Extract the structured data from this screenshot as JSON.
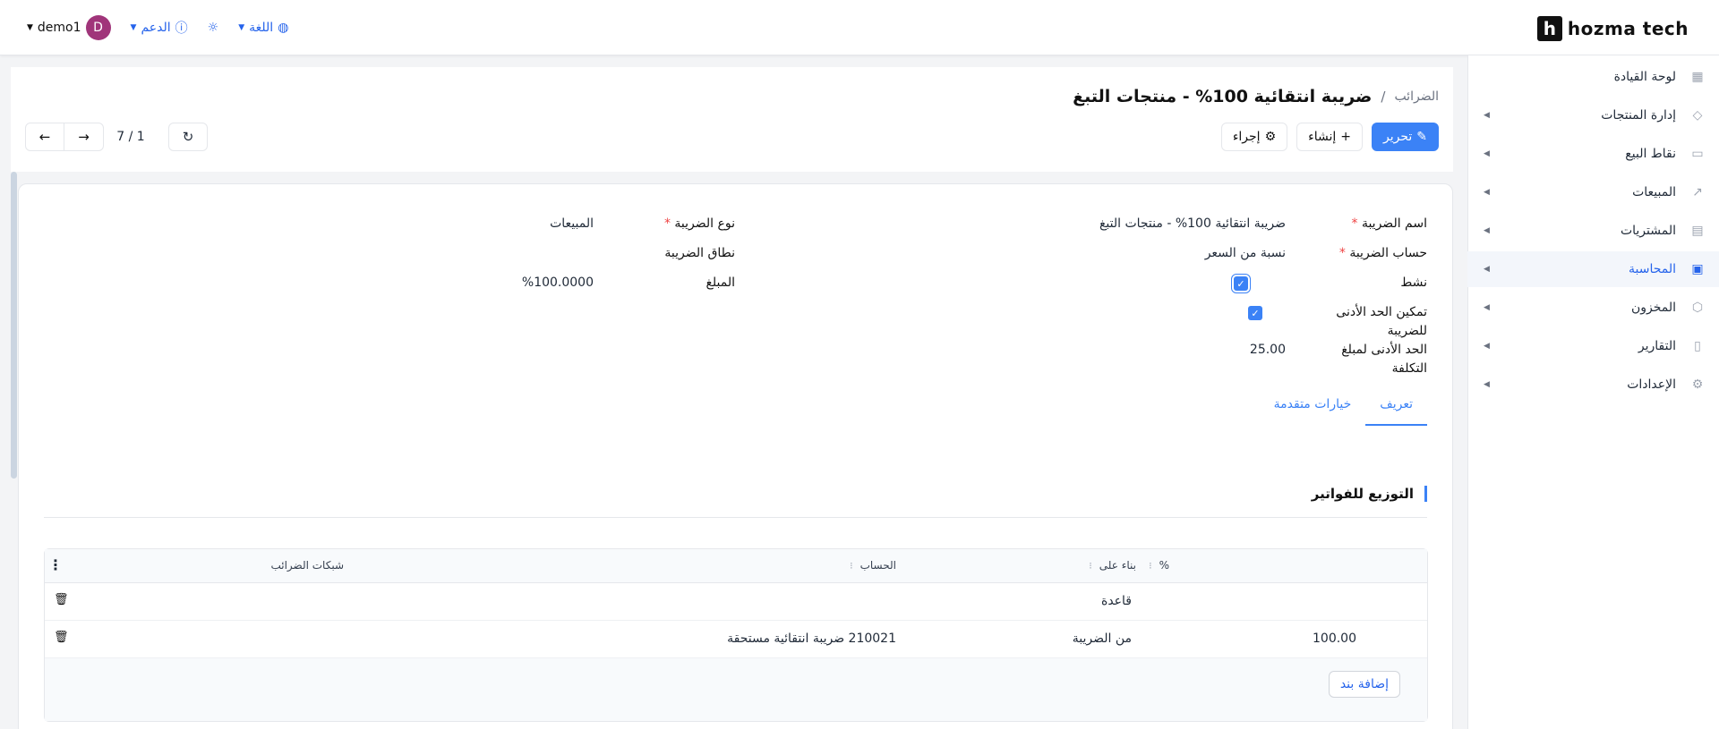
{
  "brand": {
    "logo_letter": "h",
    "name": "hozma tech"
  },
  "topbar": {
    "user": "demo1",
    "avatar_letter": "D",
    "support": "الدعم",
    "language": "اللغة"
  },
  "sidebar": {
    "items": [
      {
        "label": "لوحة القيادة",
        "icon": "dashboard-icon"
      },
      {
        "label": "إدارة المنتجات",
        "icon": "tag-icon"
      },
      {
        "label": "نقاط البيع",
        "icon": "store-icon"
      },
      {
        "label": "المبيعات",
        "icon": "chart-line-icon"
      },
      {
        "label": "المشتريات",
        "icon": "wallet-icon"
      },
      {
        "label": "المحاسبة",
        "icon": "calculator-icon"
      },
      {
        "label": "المخزون",
        "icon": "box-icon"
      },
      {
        "label": "التقارير",
        "icon": "report-icon"
      },
      {
        "label": "الإعدادات",
        "icon": "gear-icon"
      }
    ]
  },
  "header": {
    "breadcrumb_parent": "الضرائب",
    "breadcrumb_sep": "/",
    "title": "ضريبة انتقائية 100% - منتجات التبغ",
    "edit_label": "تحرير",
    "create_label": "إنشاء",
    "action_label": "إجراء",
    "pager": "7 / 1"
  },
  "form": {
    "tax_name_label": "اسم الضريبة",
    "tax_name_value": "ضريبة انتقائية 100% - منتجات التبغ",
    "tax_computation_label": "حساب الضريبة",
    "tax_computation_value": "نسبة من السعر",
    "active_label": "نشط",
    "enable_min_label_1": "تمكين الحد الأدنى",
    "enable_min_label_2": "للضريبة",
    "min_cost_label_1": "الحد الأدنى لمبلغ",
    "min_cost_label_2": "التكلفة",
    "min_cost_value": "25.00",
    "tax_type_label": "نوع الضريبة",
    "tax_type_value": "المبيعات",
    "tax_scope_label": "نطاق الضريبة",
    "amount_label": "المبلغ",
    "amount_value": "%100.0000",
    "required_mark": "*"
  },
  "tabs": [
    {
      "label": "تعريف",
      "active": true
    },
    {
      "label": "خيارات متقدمة",
      "active": false
    }
  ],
  "section": {
    "title": "التوزيع للفواتير"
  },
  "table": {
    "columns": [
      "%",
      "بناء على",
      "الحساب",
      "شبكات الضرائب"
    ],
    "rows": [
      {
        "percent": "",
        "based_on": "قاعدة",
        "account": "",
        "grids": ""
      },
      {
        "percent": "100.00",
        "based_on": "من الضريبة",
        "account": "210021 ضريبة انتقائية مستحقة",
        "grids": ""
      }
    ],
    "add_line": "إضافة بند"
  },
  "colors": {
    "accent": "#3b82f6",
    "avatar": "#a0357a"
  }
}
